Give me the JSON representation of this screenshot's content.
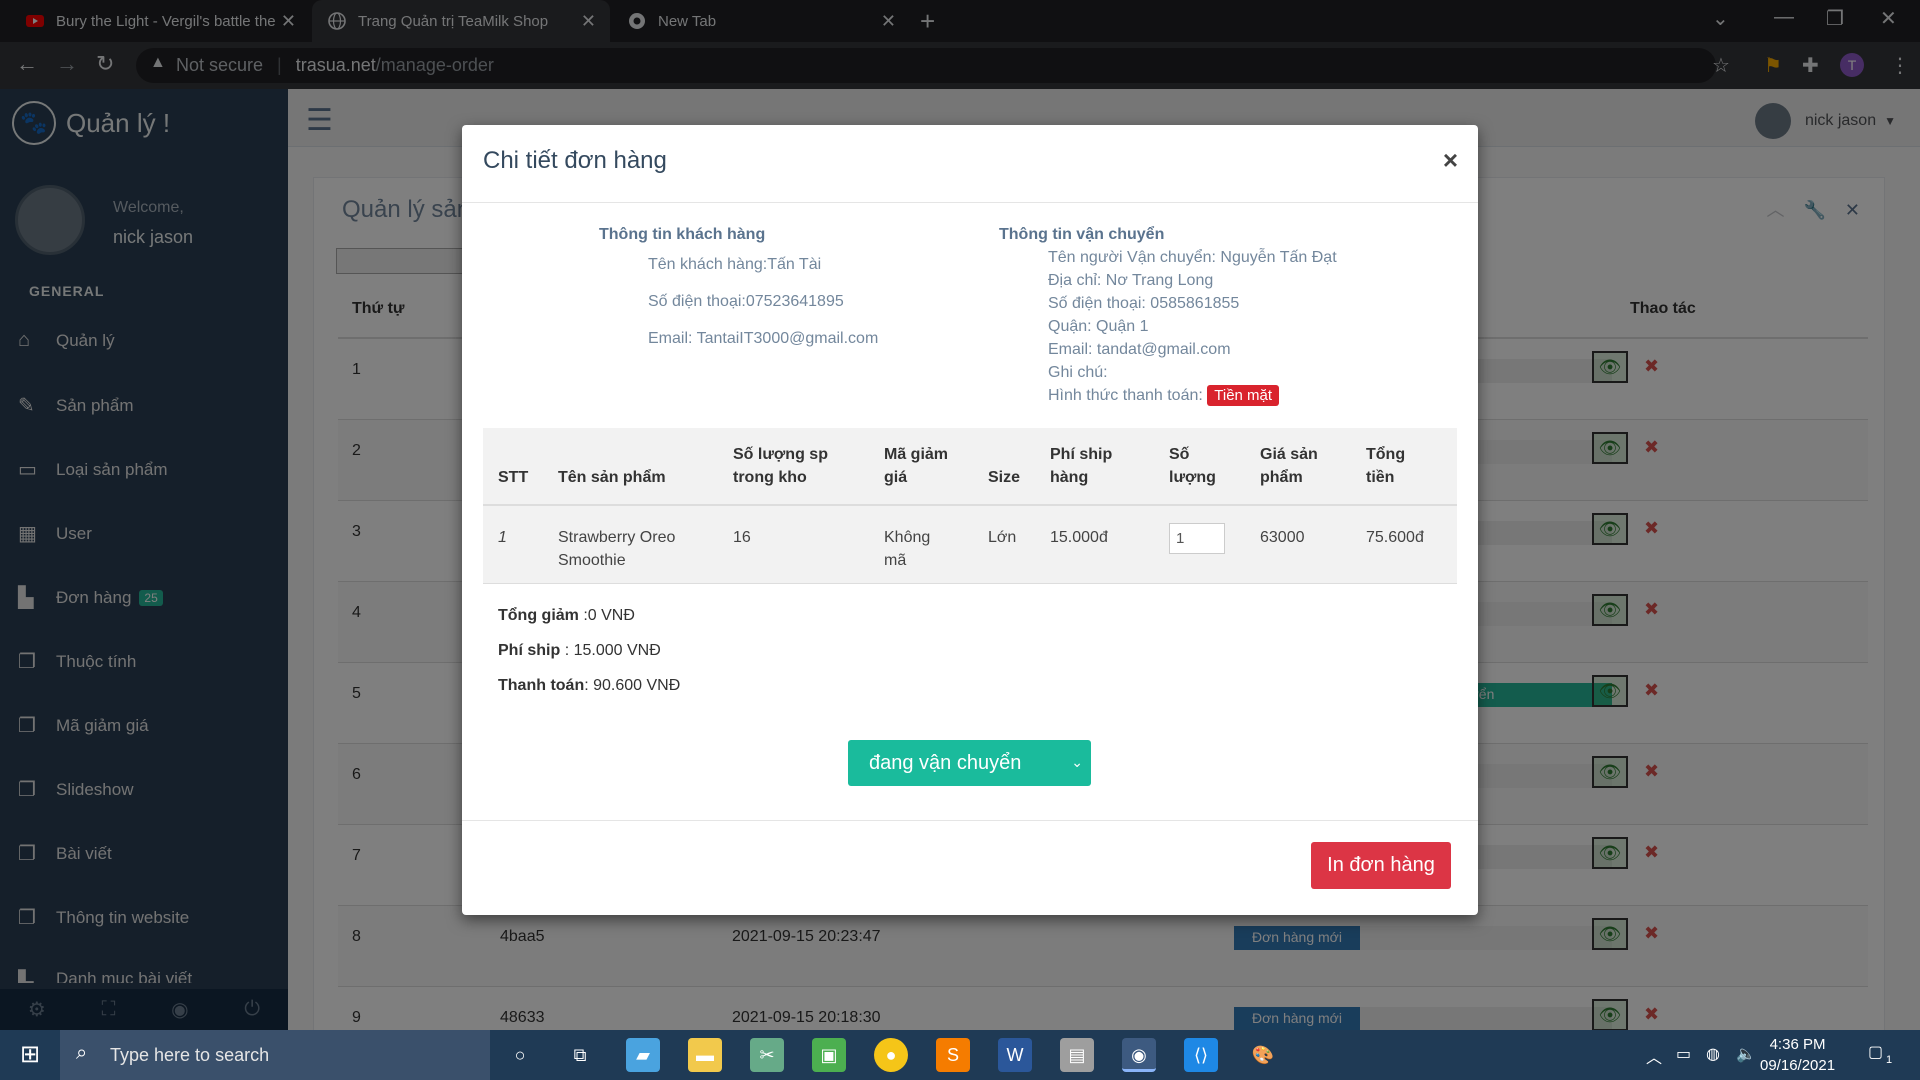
{
  "browser": {
    "tabs": [
      {
        "title": "Bury the Light - Vergil's battle the",
        "icon": "youtube-icon",
        "active": false
      },
      {
        "title": "Trang Quản trị TeaMilk Shop",
        "icon": "globe-icon",
        "active": true
      },
      {
        "title": "New Tab",
        "icon": "chrome-icon",
        "active": false
      }
    ],
    "security_label": "Not secure",
    "url_domain": "trasua.net",
    "url_path": "/manage-order",
    "profile_initial": "T"
  },
  "sidebar": {
    "brand": "Quản lý !",
    "welcome": "Welcome,",
    "user_name": "nick jason",
    "section": "GENERAL",
    "items": [
      {
        "label": "Quản lý",
        "icon": "home-icon"
      },
      {
        "label": "Sản phẩm",
        "icon": "edit-icon"
      },
      {
        "label": "Loại sản phẩm",
        "icon": "desktop-icon"
      },
      {
        "label": "User",
        "icon": "table-icon"
      },
      {
        "label": "Đơn hàng",
        "icon": "bar-chart-icon",
        "badge": "25"
      },
      {
        "label": "Thuộc tính",
        "icon": "clone-icon"
      },
      {
        "label": "Mã giảm giá",
        "icon": "clone-icon"
      },
      {
        "label": "Slideshow",
        "icon": "clone-icon"
      },
      {
        "label": "Bài viết",
        "icon": "clone-icon"
      },
      {
        "label": "Thông tin website",
        "icon": "clone-icon"
      },
      {
        "label": "Danh mục bài viết",
        "icon": "bar-chart-icon"
      }
    ]
  },
  "topnav": {
    "user_name": "nick jason"
  },
  "panel": {
    "title": "Quản lý sản",
    "columns": {
      "order": "Thứ tự",
      "actions": "Thao tác"
    },
    "rows": [
      {
        "order": "1",
        "code": "",
        "date": "",
        "status": ""
      },
      {
        "order": "2",
        "code": "",
        "date": "",
        "status": ""
      },
      {
        "order": "3",
        "code": "",
        "date": "",
        "status": ""
      },
      {
        "order": "4",
        "code": "",
        "date": "",
        "status": ""
      },
      {
        "order": "5",
        "code": "",
        "date": "",
        "status": "uyển"
      },
      {
        "order": "6",
        "code": "",
        "date": "",
        "status": ""
      },
      {
        "order": "7",
        "code": "",
        "date": "",
        "status": ""
      },
      {
        "order": "8",
        "code": "4baa5",
        "date": "2021-09-15 20:23:47",
        "status": "Đơn hàng mới"
      },
      {
        "order": "9",
        "code": "48633",
        "date": "2021-09-15 20:18:30",
        "status": "Đơn hàng mới"
      }
    ]
  },
  "modal": {
    "title": "Chi tiết đơn hàng",
    "customer": {
      "heading": "Thông tin khách hàng",
      "name": "Tên khách hàng:Tấn Tài",
      "phone": "Số điện thoại:07523641895",
      "email": "Email: TantaiIT3000@gmail.com"
    },
    "shipping": {
      "heading": "Thông tin vận chuyển",
      "name": "Tên người Vận chuyển: Nguyễn Tấn Đạt",
      "address": "Địa chỉ: Nơ Trang Long",
      "phone": "Số điện thoại: 0585861855",
      "district": "Quận: Quận 1",
      "email": "Email: tandat@gmail.com",
      "note": "Ghi chú:",
      "payment_label": "Hình thức thanh toán:",
      "payment_value": "Tiền mặt"
    },
    "table": {
      "headers": {
        "stt": "STT",
        "name": "Tên sản phẩm",
        "stock1": "Số lượng sp",
        "stock2": "trong kho",
        "coupon1": "Mã giảm",
        "coupon2": "giá",
        "size": "Size",
        "ship1": "Phí ship",
        "ship2": "hàng",
        "qty1": "Số",
        "qty2": "lượng",
        "price1": "Giá sản",
        "price2": "phẩm",
        "total1": "Tổng",
        "total2": "tiền"
      },
      "rows": [
        {
          "stt": "1",
          "name1": "Strawberry Oreo",
          "name2": "Smoothie",
          "stock": "16",
          "coupon1": "Không",
          "coupon2": "mã",
          "size": "Lớn",
          "ship": "15.000đ",
          "qty": "1",
          "price": "63000",
          "total": "75.600đ"
        }
      ]
    },
    "summary": {
      "discount_label": "Tổng giảm",
      "discount_value": ":0 VNĐ",
      "ship_label": "Phí ship",
      "ship_value": ": 15.000 VNĐ",
      "pay_label": "Thanh toán",
      "pay_value": ": 90.600 VNĐ"
    },
    "status_select": "đang vận chuyển",
    "print_button": "In đơn hàng"
  },
  "taskbar": {
    "search_placeholder": "Type here to search",
    "time": "4:36 PM",
    "date": "09/16/2021",
    "notification_count": "1"
  }
}
